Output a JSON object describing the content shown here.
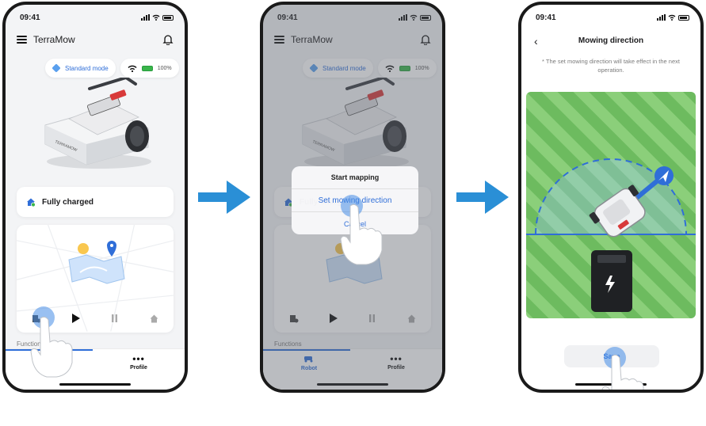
{
  "status": {
    "time": "09:41"
  },
  "app": {
    "title": "TerraMow"
  },
  "header": {
    "mode_label": "Standard mode",
    "battery_text": "100%"
  },
  "robot_card": {
    "status": "Fully charged"
  },
  "sections": {
    "functions_label": "Functions"
  },
  "tabs": {
    "robot": "Robot",
    "profile": "Profile"
  },
  "mower_brand": "TERRAMOW",
  "menu": {
    "title": "Start mapping",
    "item": "Set mowing direction",
    "cancel": "Cancel"
  },
  "direction_screen": {
    "title": "Mowing direction",
    "note": "* The set mowing direction will take effect in the next operation.",
    "save": "Save"
  },
  "colors": {
    "accent": "#2f6ed8",
    "arrow": "#2a8fd6",
    "lawn_light": "#8bcf7a",
    "lawn_dark": "#6dbb5f",
    "charge_icon": "#39b54a"
  },
  "icons": [
    "menu-icon",
    "bell-icon",
    "cube-icon",
    "wifi-icon",
    "battery-icon",
    "home-icon",
    "map-icon",
    "play-icon",
    "pause-icon",
    "back-icon",
    "navigation-arrow-icon",
    "lightning-icon",
    "hand-icon"
  ]
}
